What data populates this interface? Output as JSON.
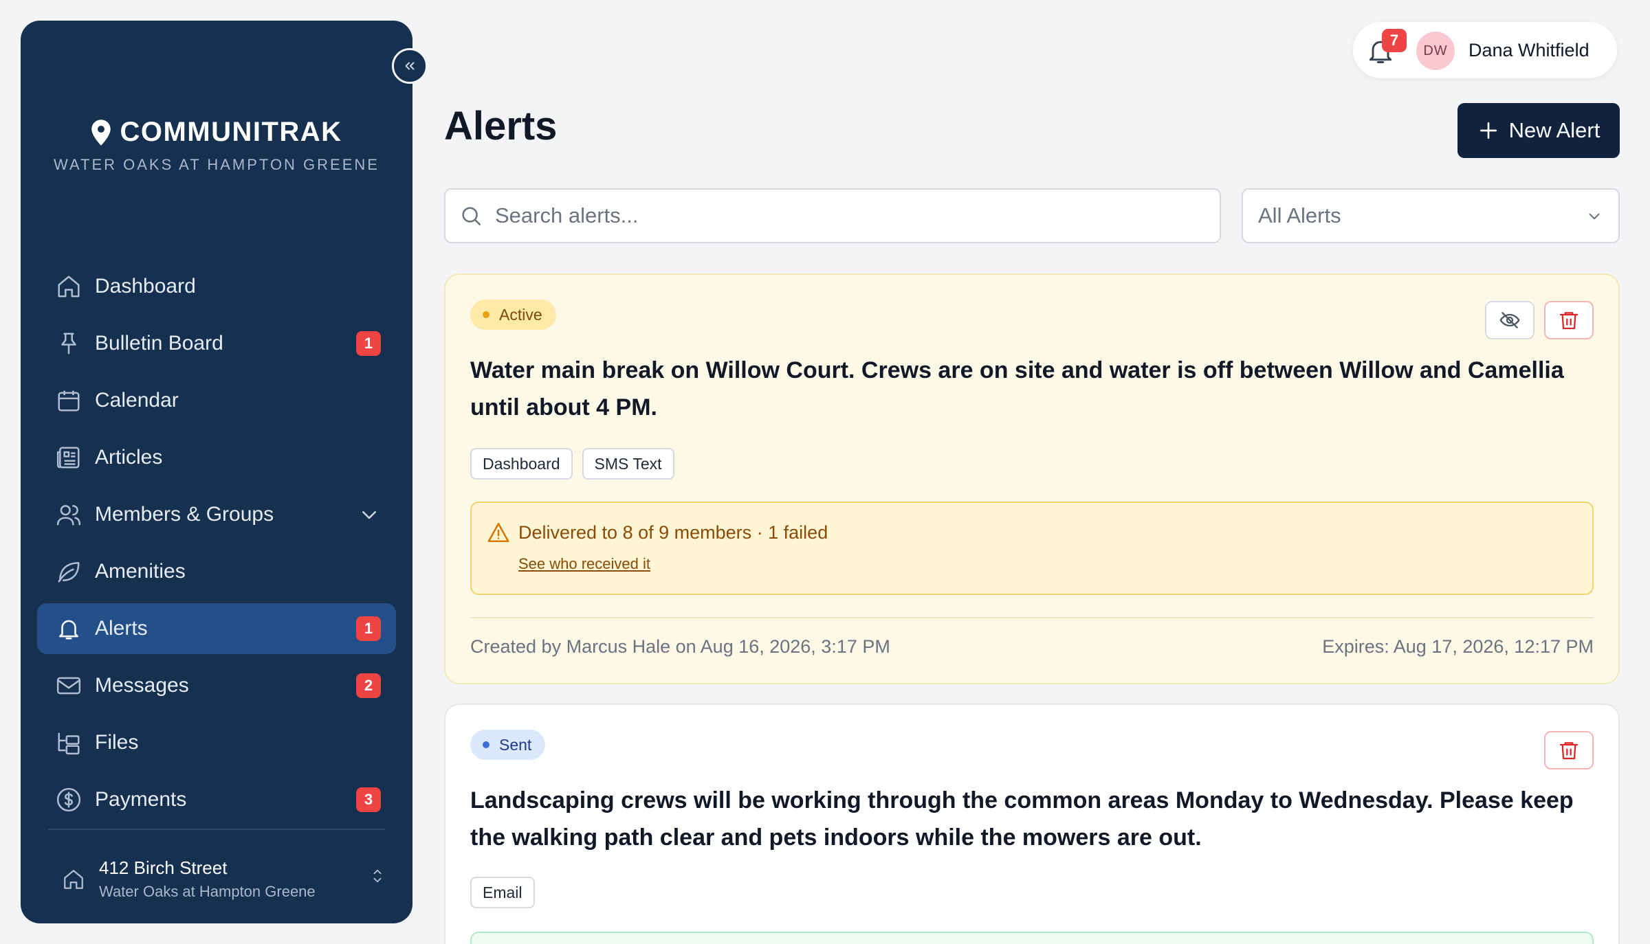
{
  "sidebar": {
    "brand_name": "COMMUNITRAK",
    "brand_subtitle": "WATER OAKS AT HAMPTON GREENE",
    "items": [
      {
        "label": "Dashboard",
        "icon": "home-icon"
      },
      {
        "label": "Bulletin Board",
        "icon": "pin-icon",
        "badge": "1"
      },
      {
        "label": "Calendar",
        "icon": "calendar-icon"
      },
      {
        "label": "Articles",
        "icon": "newspaper-icon"
      },
      {
        "label": "Members & Groups",
        "icon": "users-icon"
      },
      {
        "label": "Amenities",
        "icon": "leaf-icon"
      },
      {
        "label": "Alerts",
        "icon": "bell-icon",
        "badge": "1",
        "active": true
      },
      {
        "label": "Messages",
        "icon": "mail-icon",
        "badge": "2"
      },
      {
        "label": "Files",
        "icon": "folder-tree-icon"
      },
      {
        "label": "Payments",
        "icon": "dollar-circle-icon",
        "badge": "3"
      }
    ],
    "property": {
      "street": "412 Birch Street",
      "community": "Water Oaks at Hampton Greene"
    }
  },
  "header": {
    "notification_count": "7",
    "user_initials": "DW",
    "user_name": "Dana Whitfield"
  },
  "main": {
    "title": "Alerts",
    "new_button_label": "New Alert",
    "search_placeholder": "Search alerts...",
    "filter_value": "All Alerts"
  },
  "alerts": [
    {
      "status": "Active",
      "message": "Water main break on Willow Court. Crews are on site and water is off between Willow and Camellia until about 4 PM.",
      "channels": [
        "Dashboard",
        "SMS Text"
      ],
      "delivery_text": "Delivered to 8 of 9 members · 1 failed",
      "delivery_link": "See who received it",
      "created": "Created by Marcus Hale on Aug 16, 2026, 3:17 PM",
      "expires": "Expires: Aug 17, 2026, 12:17 PM"
    },
    {
      "status": "Sent",
      "message": "Landscaping crews will be working through the common areas Monday to Wednesday. Please keep the walking path clear and pets indoors while the mowers are out.",
      "channels": [
        "Email"
      ]
    }
  ],
  "colors": {
    "sidebar_bg": "#16304f",
    "sidebar_active": "#24508a",
    "primary_button": "#10223d",
    "badge_red": "#ef4444",
    "active_card_bg": "#fef9e7"
  }
}
